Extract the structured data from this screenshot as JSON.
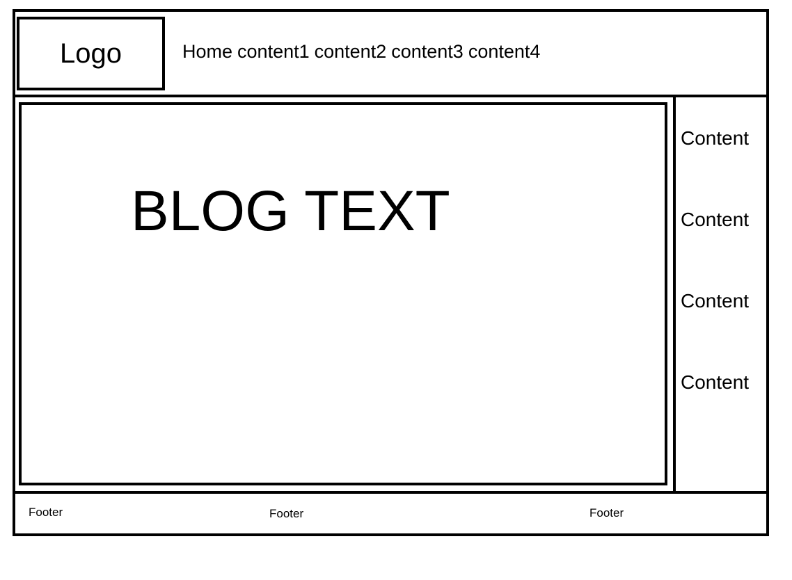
{
  "header": {
    "logo": "Logo",
    "nav": [
      "Home",
      "content1",
      "content2",
      "content3",
      "content4"
    ]
  },
  "main": {
    "blog_text": "BLOG TEXT"
  },
  "sidebar": {
    "items": [
      "Content",
      "Content",
      "Content",
      "Content"
    ]
  },
  "footer": {
    "items": [
      "Footer",
      "Footer",
      "Footer"
    ]
  }
}
